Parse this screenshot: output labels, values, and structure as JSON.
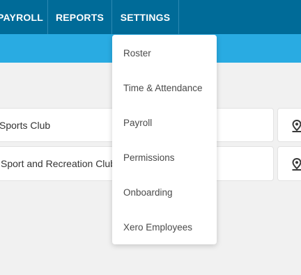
{
  "nav": {
    "items": [
      "PAYROLL",
      "REPORTS",
      "SETTINGS"
    ]
  },
  "locations": [
    {
      "name": "Sports Club"
    },
    {
      "name": "Sport and Recreation Club"
    }
  ],
  "settings_menu": {
    "items": [
      "Roster",
      "Time & Attendance",
      "Payroll",
      "Permissions",
      "Onboarding",
      "Xero Employees"
    ]
  },
  "icons": {
    "location": "map-pin-icon"
  },
  "colors": {
    "nav_bg": "#006b98",
    "subbar_bg": "#29abe2",
    "page_bg": "#f1f1f1"
  }
}
